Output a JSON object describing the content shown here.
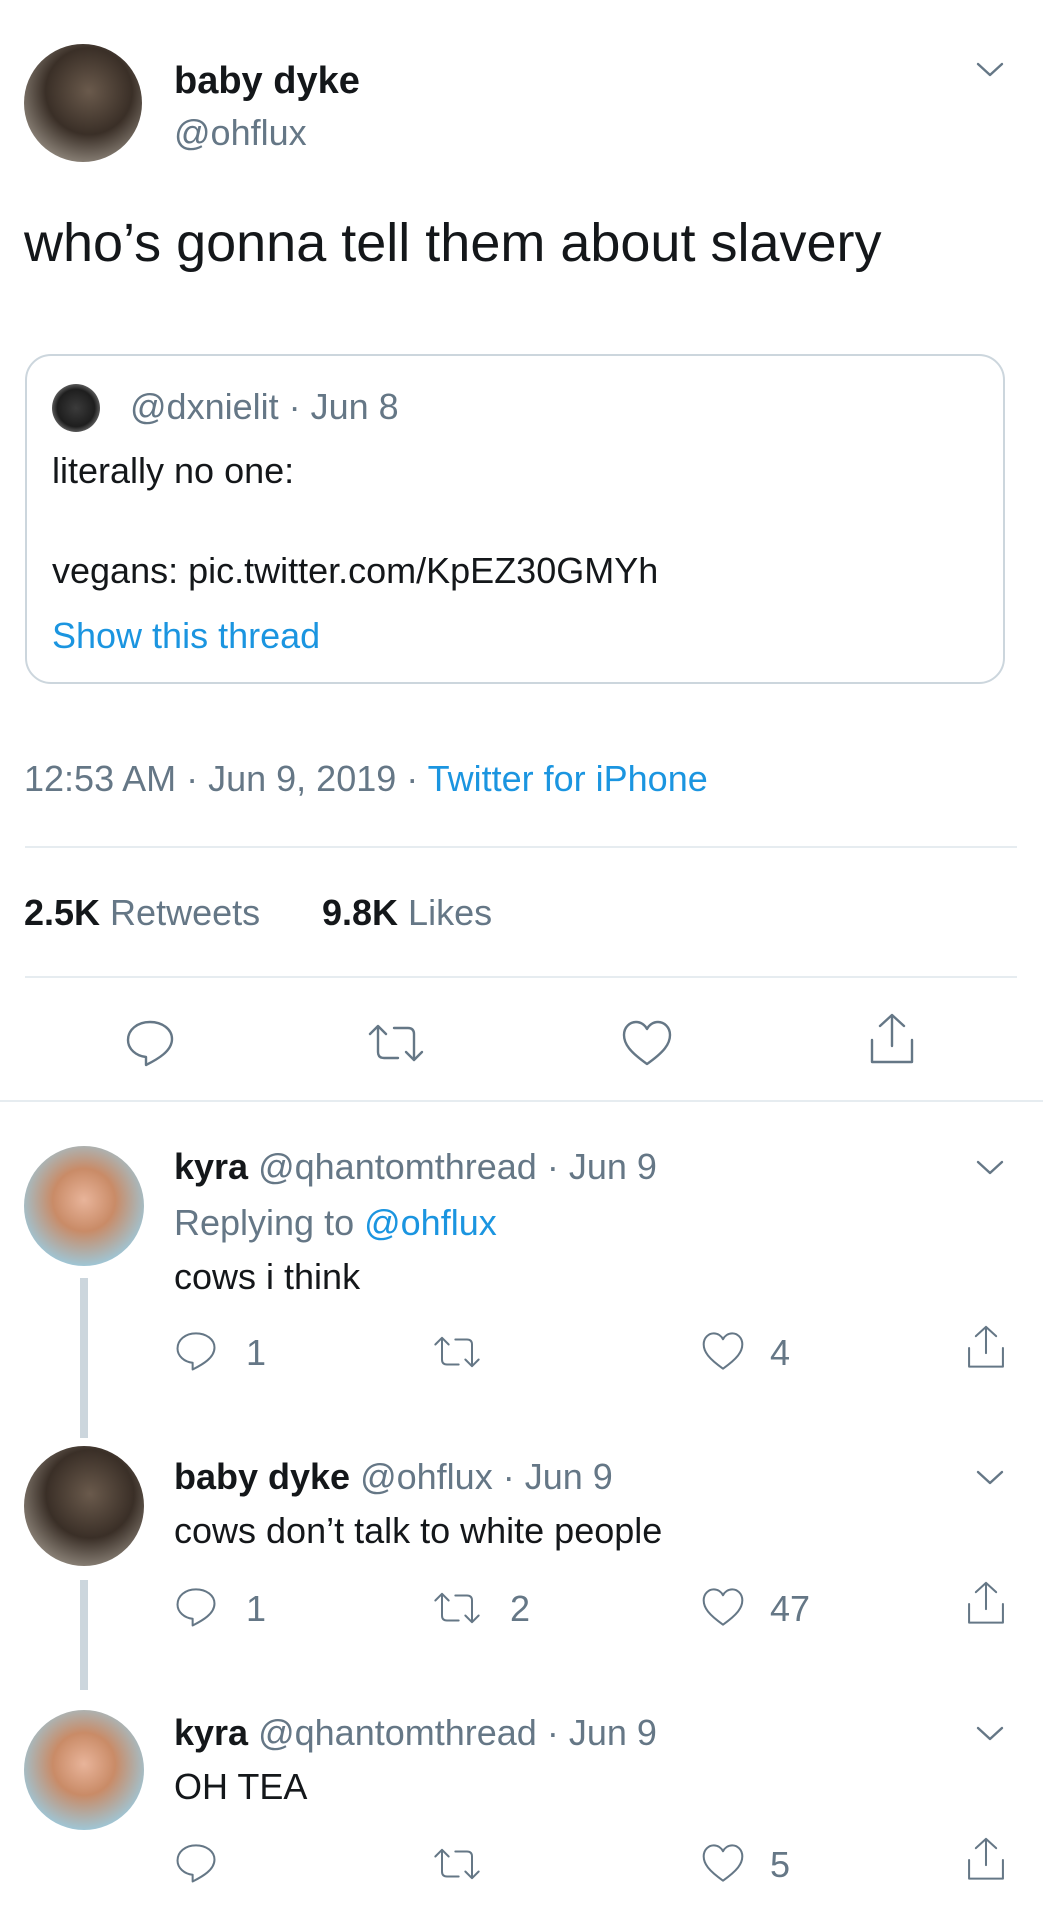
{
  "main_tweet": {
    "display_name": "baby dyke",
    "handle": "@ohflux",
    "text": "who’s gonna tell them about slavery",
    "quoted": {
      "handle": "@dxnielit",
      "sep": " · ",
      "date": "Jun 8",
      "line1": "literally no one:",
      "line2": "vegans: pic.twitter.com/KpEZ30GMYh",
      "show_thread": "Show this thread"
    },
    "time": "12:53 AM",
    "sep1": " · ",
    "date": "Jun 9, 2019",
    "sep2": " · ",
    "source": "Twitter for iPhone",
    "retweets_count": "2.5K",
    "retweets_label": " Retweets",
    "likes_count": "9.8K",
    "likes_label": " Likes"
  },
  "replies": [
    {
      "display_name": "kyra",
      "handle": " @qhantomthread",
      "sep": " · ",
      "date": "Jun 9",
      "replying_label": "Replying to ",
      "replying_to": "@ohflux",
      "text": "cows i think",
      "reply_count": "1",
      "retweet_count": "",
      "like_count": "4"
    },
    {
      "display_name": "baby dyke",
      "handle": " @ohflux",
      "sep": " · ",
      "date": "Jun 9",
      "text": "cows don’t talk to white people",
      "reply_count": "1",
      "retweet_count": "2",
      "like_count": "47"
    },
    {
      "display_name": "kyra",
      "handle": " @qhantomthread",
      "sep": " · ",
      "date": "Jun 9",
      "text": "OH TEA",
      "reply_count": "",
      "retweet_count": "",
      "like_count": "5"
    }
  ],
  "colors": {
    "link": "#1b95e0",
    "muted": "#657786",
    "border": "#e6ecf0",
    "text": "#14171a"
  },
  "icons": [
    "chevron-down-icon",
    "reply-icon",
    "retweet-icon",
    "like-icon",
    "share-icon"
  ]
}
